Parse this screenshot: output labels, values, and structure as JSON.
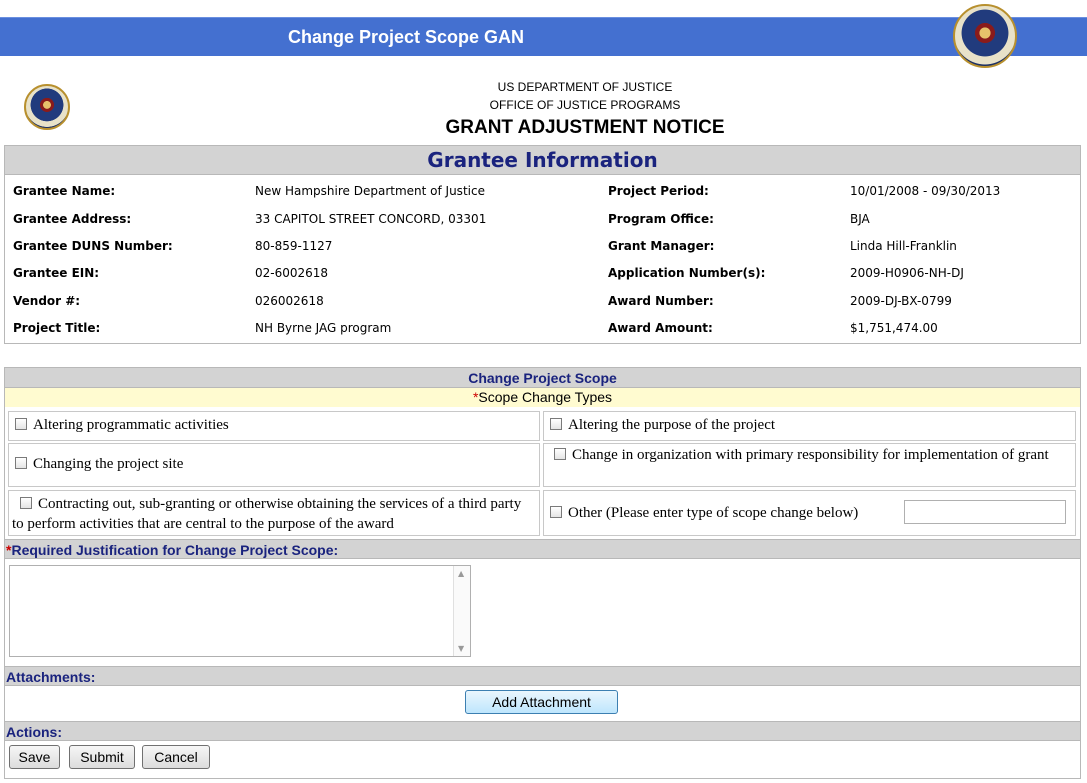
{
  "window": {
    "title": "Change Project Scope GAN"
  },
  "icons": {
    "seal": "doj-seal-icon",
    "checkbox": "checkbox-icon"
  },
  "header": {
    "line1": "US DEPARTMENT OF JUSTICE",
    "line2": "OFFICE OF JUSTICE PROGRAMS",
    "line3": "GRANT ADJUSTMENT NOTICE"
  },
  "grantee": {
    "heading": "Grantee Information",
    "left": [
      {
        "label": "Grantee Name:",
        "value": "New Hampshire Department of Justice"
      },
      {
        "label": "Grantee Address:",
        "value": "33 CAPITOL STREET CONCORD, 03301"
      },
      {
        "label": "Grantee DUNS Number:",
        "value": "80-859-1127"
      },
      {
        "label": "Grantee EIN:",
        "value": "02-6002618"
      },
      {
        "label": "Vendor #:",
        "value": "026002618"
      },
      {
        "label": "Project Title:",
        "value": "NH Byrne JAG program"
      }
    ],
    "right": [
      {
        "label": "Project Period:",
        "value": "10/01/2008 - 09/30/2013"
      },
      {
        "label": "Program Office:",
        "value": "BJA"
      },
      {
        "label": "Grant Manager:",
        "value": "Linda Hill-Franklin"
      },
      {
        "label": "Application Number(s):",
        "value": "2009-H0906-NH-DJ"
      },
      {
        "label": "Award Number:",
        "value": "2009-DJ-BX-0799"
      },
      {
        "label": "Award Amount:",
        "value": "$1,751,474.00"
      }
    ]
  },
  "scope": {
    "heading": "Change Project Scope",
    "types_required_mark": "*",
    "types_label": "Scope Change Types",
    "options": {
      "altering_activities": "Altering programmatic activities",
      "altering_purpose": "Altering the purpose of the project",
      "changing_site": "Changing the project site",
      "change_org": "Change in organization with primary responsibility for implementation of grant",
      "contracting": "Contracting out, sub-granting or otherwise obtaining the services of a third party to perform activities that are central to the purpose of the award",
      "other": "Other (Please enter type of scope change below)"
    },
    "other_value": "",
    "justification_required_mark": "*",
    "justification_label": "Required Justification for Change Project Scope:",
    "justification_value": ""
  },
  "attachments": {
    "label": "Attachments:",
    "add_button": "Add Attachment"
  },
  "actions": {
    "label": "Actions:",
    "save": "Save",
    "submit": "Submit",
    "cancel": "Cancel"
  },
  "colors": {
    "titlebar": "#4470d0",
    "heading_text": "#1a237e",
    "section_bar": "#d3d3d3",
    "required": "#cc0000",
    "highlight": "#fffbd0"
  }
}
